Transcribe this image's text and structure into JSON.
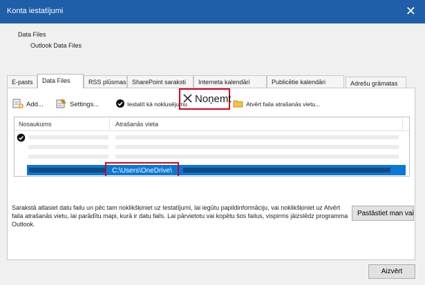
{
  "window": {
    "title": "Konta iestatījumi",
    "close_glyph": "✕"
  },
  "header": {
    "section_title": "Data Files",
    "section_subtitle": "Outlook Data Files"
  },
  "tabs": [
    {
      "label": "E-pasts"
    },
    {
      "label": "Data Files"
    },
    {
      "label": "RSS plūsmas"
    },
    {
      "label": "SharePoint saraksti"
    },
    {
      "label": "Interneta kalendāri"
    },
    {
      "label": "Publicētie kalendāri"
    },
    {
      "label": "Adrešu grāmatas"
    }
  ],
  "toolbar": {
    "add_label": "Add...",
    "settings_label": "Settings...",
    "set_default_label": "Iestatīt kā noklusējumu",
    "remove_label": "Noņemt",
    "open_location_label": "Atvērt faila atrašanās vietu..."
  },
  "list": {
    "columns": [
      "Nosaukums",
      "Atrašanās vieta"
    ],
    "selected_path": "C:\\Users\\OneDrive\\"
  },
  "description": "Sarakstā atlasiet datu failu un pēc tam noklikšķiniet uz Iestatījumi, lai iegūtu papildinformāciju, vai noklikšķiniet uz Atvērt faila atrašanās vietu, lai parādītu mapi, kurā ir datu fails. Lai pārvietotu vai kopētu šos failus, vispirms jāizslēdz programma Outlook.",
  "buttons": {
    "tell_more": "Pastāstiet man vairāk...",
    "close": "Aizvērt"
  },
  "colors": {
    "titlebar": "#1f5ea8",
    "selection": "#0a78d7",
    "highlight": "#d0021b"
  }
}
